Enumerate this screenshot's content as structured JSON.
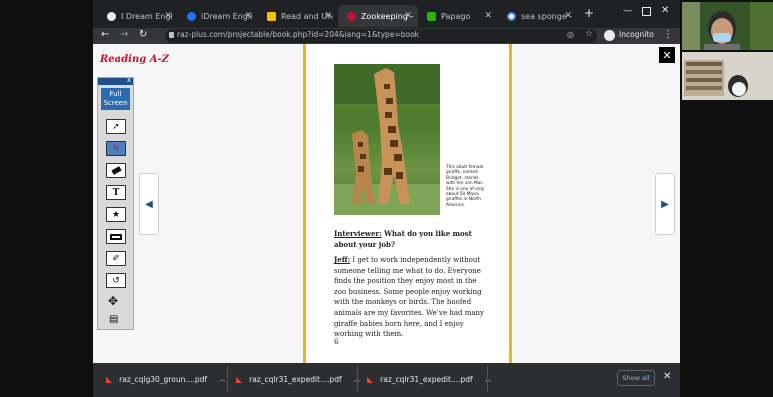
{
  "tabs": [
    {
      "title": "I Dream Englis",
      "icon": "github-icon",
      "active": false
    },
    {
      "title": "iDream Englis",
      "icon": "facebook-icon",
      "active": false
    },
    {
      "title": "Read and Und",
      "icon": "drive-icon",
      "active": false
    },
    {
      "title": "Zookeeping -",
      "icon": "reading-az-icon",
      "active": true
    },
    {
      "title": "Papago",
      "icon": "papago-icon",
      "active": false
    },
    {
      "title": "sea sponge -",
      "icon": "google-icon",
      "active": false
    }
  ],
  "new_tab_label": "+",
  "address_bar": {
    "url": "raz-plus.com/projectable/book.php?id=204&lang=1&type=book"
  },
  "profile": {
    "label": "Incognito"
  },
  "viewer": {
    "logo": "Reading A-Z",
    "tools_close": "x",
    "fullscreen_label": "Full Screen",
    "tools": [
      "pointer-icon",
      "pen-icon",
      "eraser-icon",
      "text-tool-icon",
      "star-stamp-icon",
      "highlight-box-icon",
      "clear-icon",
      "undo-icon",
      "move-icon",
      "print-icon"
    ],
    "text_tool_glyph": "T",
    "prev_glyph": "◀",
    "next_glyph": "▶",
    "close_glyph": "✕"
  },
  "book": {
    "caption": "This adult female giraffe, named Bridget, stands with her son Mac. She is one of only about 50 Masai giraffes in North America.",
    "question_label": "Interviewer:",
    "question_text": " What do you like most about your job?",
    "answer_label": "Jeff:",
    "answer_text": " I get to work independently without someone telling me what to do. Everyone finds the position they enjoy most in the zoo business. Some people enjoy working with the monkeys or birds. The hoofed animals are my favorites. We’ve had many giraffe babies born here, and I enjoy working with them.",
    "page_number": "6"
  },
  "downloads": [
    {
      "name": "raz_cqlg30_groun....pdf"
    },
    {
      "name": "raz_cqlr31_expedit....pdf"
    },
    {
      "name": "raz_cqlr31_expedit....pdf"
    }
  ],
  "show_all_label": "Show all",
  "download_close_glyph": "✕",
  "colors": {
    "accent": "#f1b31c",
    "brand_red": "#c8102e",
    "tool_blue": "#2b6cb0"
  }
}
